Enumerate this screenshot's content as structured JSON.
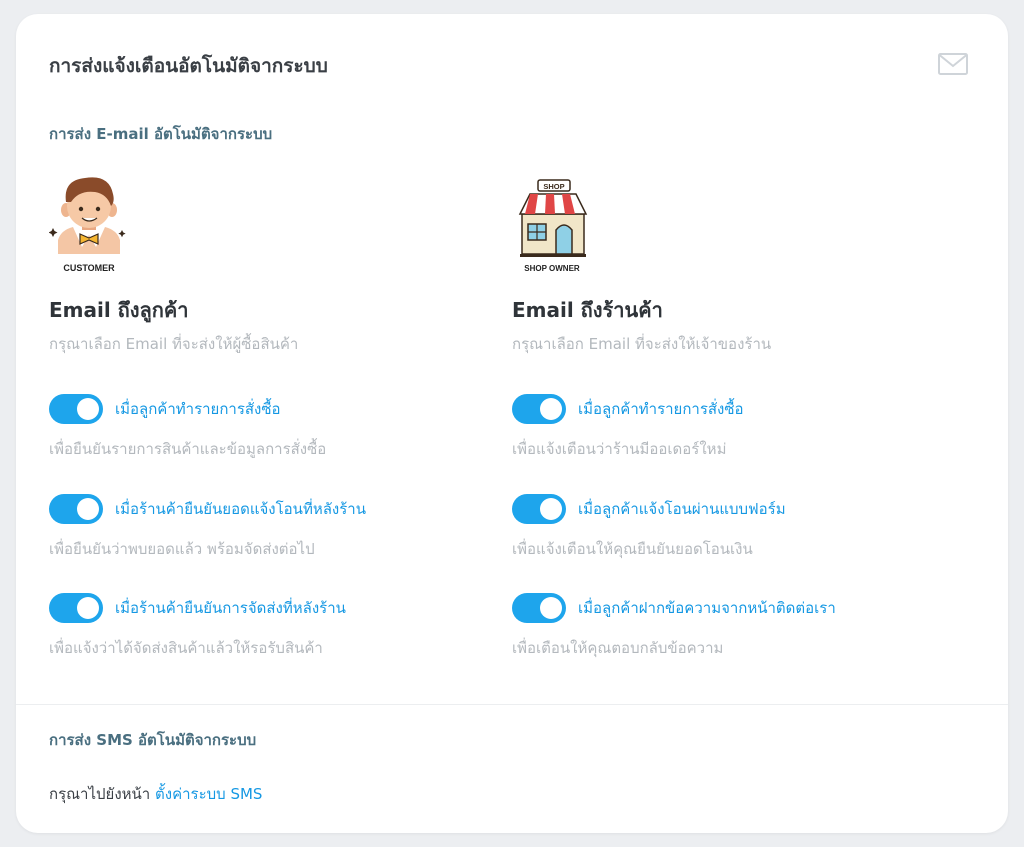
{
  "card": {
    "title": "การส่งแจ้งเตือนอัตโนมัติจากระบบ",
    "icon": "mail-icon"
  },
  "email_section": {
    "label": "การส่ง E-mail อัตโนมัติจากระบบ"
  },
  "customer": {
    "badge_text": "CUSTOMER",
    "heading": "Email ถึงลูกค้า",
    "subtitle": "กรุณาเลือก Email ที่จะส่งให้ผู้ซื้อสินค้า",
    "options": [
      {
        "label": "เมื่อลูกค้าทำรายการสั่งซื้อ",
        "desc": "เพื่อยืนยันรายการสินค้าและข้อมูลการสั่งซื้อ",
        "enabled": true
      },
      {
        "label": "เมื่อร้านค้ายืนยันยอดแจ้งโอนที่หลังร้าน",
        "desc": "เพื่อยืนยันว่าพบยอดแล้ว พร้อมจัดส่งต่อไป",
        "enabled": true
      },
      {
        "label": "เมื่อร้านค้ายืนยันการจัดส่งที่หลังร้าน",
        "desc": "เพื่อแจ้งว่าได้จัดส่งสินค้าแล้วให้รอรับสินค้า",
        "enabled": true
      }
    ]
  },
  "shop": {
    "sign_text": "SHOP",
    "badge_text": "SHOP OWNER",
    "heading": "Email ถึงร้านค้า",
    "subtitle": "กรุณาเลือก Email ที่จะส่งให้เจ้าของร้าน",
    "options": [
      {
        "label": "เมื่อลูกค้าทำรายการสั่งซื้อ",
        "desc": "เพื่อแจ้งเตือนว่าร้านมีออเดอร์ใหม่",
        "enabled": true
      },
      {
        "label": "เมื่อลูกค้าแจ้งโอนผ่านแบบฟอร์ม",
        "desc": "เพื่อแจ้งเตือนให้คุณยืนยันยอดโอนเงิน",
        "enabled": true
      },
      {
        "label": "เมื่อลูกค้าฝากข้อความจากหน้าติดต่อเรา",
        "desc": "เพื่อเตือนให้คุณตอบกลับข้อความ",
        "enabled": true
      }
    ]
  },
  "sms_section": {
    "label": "การส่ง SMS อัตโนมัติจากระบบ",
    "text": "กรุณาไปยังหน้า",
    "link": "ตั้งค่าระบบ SMS"
  },
  "colors": {
    "accent": "#1ea5ec",
    "link": "#1598e3",
    "section_label": "#4a6f80",
    "muted": "#b3b8bd"
  }
}
